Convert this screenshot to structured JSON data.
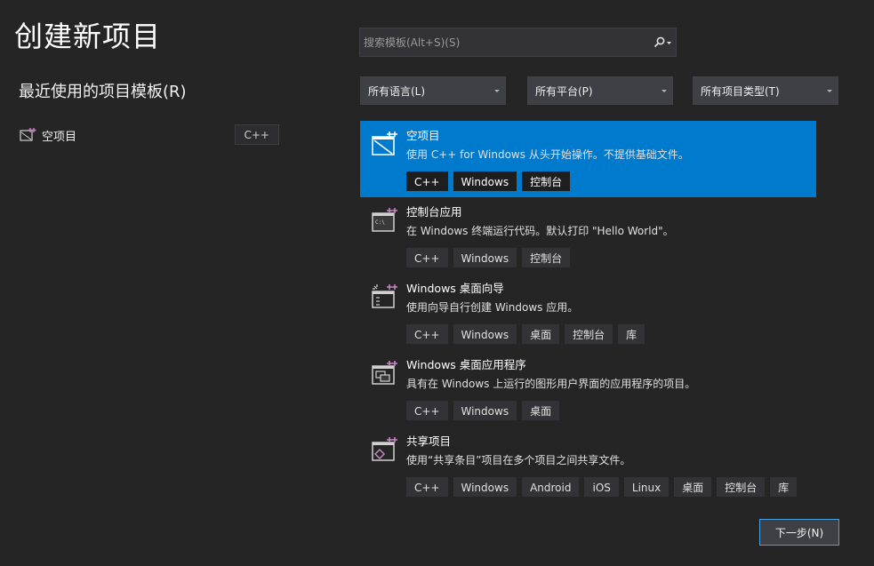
{
  "page": {
    "title": "创建新项目"
  },
  "recent": {
    "title": "最近使用的项目模板(R)",
    "items": [
      {
        "label": "空项目",
        "tag": "C++",
        "icon": "empty-project-icon"
      }
    ]
  },
  "search": {
    "placeholder": "搜索模板(Alt+S)(S)"
  },
  "filters": {
    "language": "所有语言(L)",
    "platform": "所有平台(P)",
    "project_type": "所有项目类型(T)"
  },
  "templates": [
    {
      "name": "空项目",
      "desc": "使用 C++ for Windows 从头开始操作。不提供基础文件。",
      "tags": [
        "C++",
        "Windows",
        "控制台"
      ],
      "icon": "empty-project-icon",
      "selected": true
    },
    {
      "name": "控制台应用",
      "desc": "在 Windows 终端运行代码。默认打印 \"Hello World\"。",
      "tags": [
        "C++",
        "Windows",
        "控制台"
      ],
      "icon": "console-app-icon"
    },
    {
      "name": "Windows 桌面向导",
      "desc": "使用向导自行创建 Windows 应用。",
      "tags": [
        "C++",
        "Windows",
        "桌面",
        "控制台",
        "库"
      ],
      "icon": "desktop-wizard-icon"
    },
    {
      "name": "Windows 桌面应用程序",
      "desc": "具有在 Windows 上运行的图形用户界面的应用程序的项目。",
      "tags": [
        "C++",
        "Windows",
        "桌面"
      ],
      "icon": "desktop-app-icon"
    },
    {
      "name": "共享项目",
      "desc": "使用“共享条目”项目在多个项目之间共享文件。",
      "tags": [
        "C++",
        "Windows",
        "Android",
        "iOS",
        "Linux",
        "桌面",
        "控制台",
        "库"
      ],
      "icon": "shared-project-icon"
    }
  ],
  "footer": {
    "next_label": "下一步(N)"
  },
  "colors": {
    "background": "#252526",
    "accent": "#007acc",
    "plus": "#c586c0"
  }
}
